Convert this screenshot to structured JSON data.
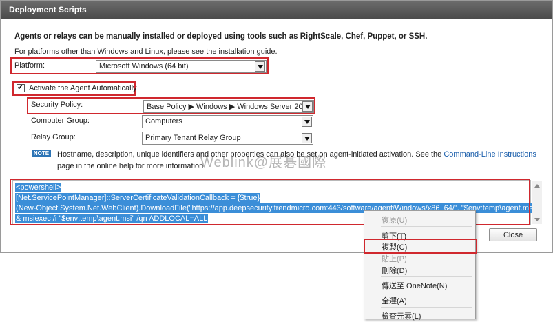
{
  "dialog": {
    "title": "Deployment Scripts",
    "heading": "Agents or relays can be manually installed or deployed using tools such as RightScale, Chef, Puppet, or SSH.",
    "subtext": "For platforms other than Windows and Linux, please see the installation guide."
  },
  "platform": {
    "label": "Platform:",
    "value": "Microsoft Windows (64 bit)"
  },
  "activate": {
    "label": "Activate the Agent Automatically",
    "checked": true
  },
  "security_policy": {
    "label": "Security Policy:",
    "value": "Base Policy ▶ Windows ▶ Windows Server 20"
  },
  "computer_group": {
    "label": "Computer Group:",
    "value": "Computers"
  },
  "relay_group": {
    "label": "Relay Group:",
    "value": "Primary Tenant Relay Group"
  },
  "note": {
    "badge": "NOTE",
    "text_before": "Hostname, description, unique identifiers and other properties can also be set on agent-initiated activation. See the",
    "link": "Command-Line Instructions",
    "text_after": "page in the online help for more information."
  },
  "watermark": "Weblink@展碁國際",
  "script_lines": [
    "<powershell>",
    "[Net.ServicePointManager]::ServerCertificateValidationCallback = {$true}",
    "(New-Object System.Net.WebClient).DownloadFile(\"https://app.deepsecurity.trendmicro.com:443/software/agent/Windows/x86_64/\", \"$env:temp\\agent.msi\")",
    "& msiexec /i \"$env:temp\\agent.msi\" /qn ADDLOCAL=ALL"
  ],
  "close_button": "Close",
  "context_menu": {
    "undo": "復原(U)",
    "cut": "剪下(T)",
    "copy": "複製(C)",
    "paste": "貼上(P)",
    "delete": "刪除(D)",
    "send_onenote": "傳送至 OneNote(N)",
    "select_all": "全選(A)",
    "inspect": "檢查元素(L)"
  },
  "colors": {
    "highlight_box": "#d0282e",
    "selection": "#3b8ed8",
    "link": "#1a5eab",
    "note_badge": "#2e75b6"
  }
}
